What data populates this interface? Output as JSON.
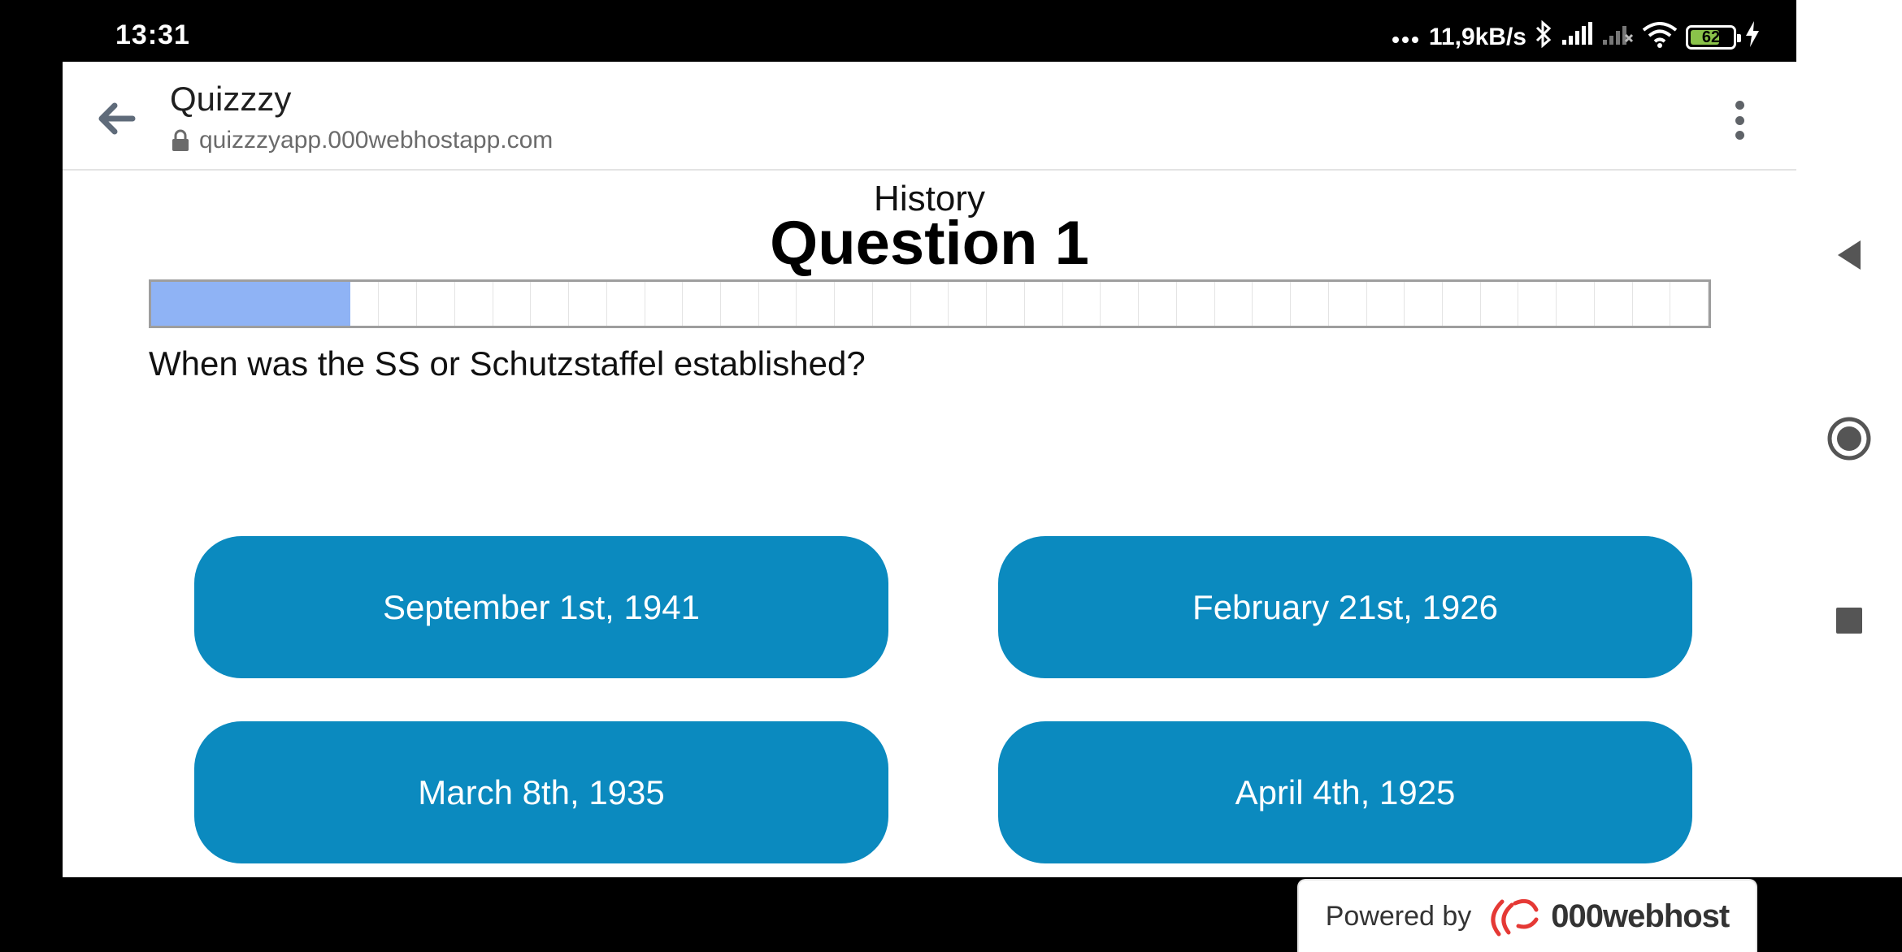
{
  "status_bar": {
    "time": "13:31",
    "network_speed": "11,9kB/s",
    "battery_level": "62",
    "icons": [
      "dots-icon",
      "bluetooth-icon",
      "signal-icon",
      "signal-no-sim-icon",
      "wifi-icon",
      "battery-icon",
      "charging-icon"
    ]
  },
  "browser": {
    "title": "Quizzzy",
    "url": "quizzzyapp.000webhostapp.com",
    "back_icon": "arrow-left-icon",
    "lock_icon": "lock-icon",
    "menu_icon": "more-vert-icon"
  },
  "quiz": {
    "category": "History",
    "question_title": "Question 1",
    "progress_fraction": 0.128,
    "progress_segments": 41,
    "question": "When was the SS or Schutzstaffel established?",
    "answers": [
      "September 1st, 1941",
      "February 21st, 1926",
      "March 8th, 1935",
      "April 4th, 1925"
    ],
    "colors": {
      "answer_bg": "#0b8abf",
      "progress_fill": "#8fb3f5"
    }
  },
  "footer": {
    "powered_by": "Powered by",
    "host_name": "000webhost"
  },
  "nav_bar": {
    "icons": [
      "nav-back-icon",
      "nav-home-icon",
      "nav-recents-icon"
    ]
  }
}
